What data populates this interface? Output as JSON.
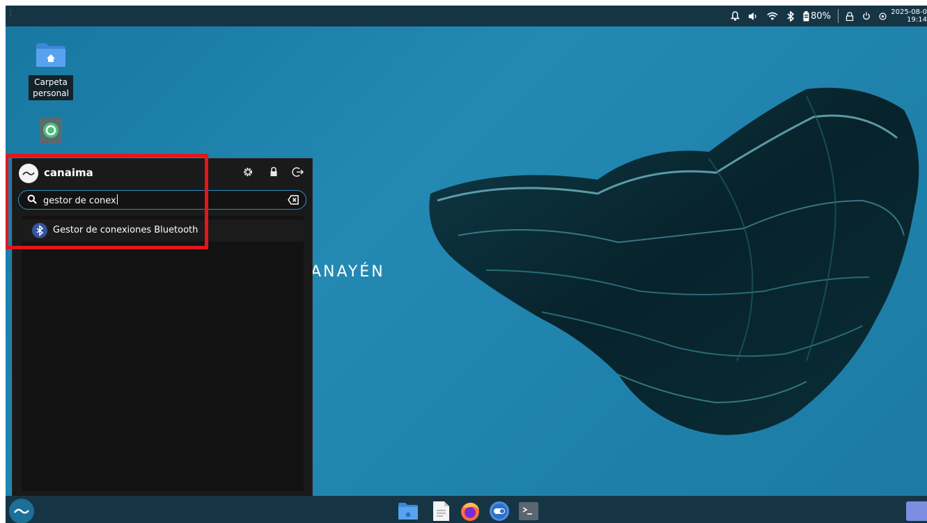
{
  "topbar": {
    "battery_percent": "80%",
    "clock_date": "2025-08-0",
    "clock_time": "19:14"
  },
  "desktop": {
    "icons": [
      {
        "label": "Carpeta personal"
      },
      {
        "label": ""
      }
    ],
    "wallpaper_text": "ANAYÉN"
  },
  "menu": {
    "username": "canaima",
    "search": {
      "value": "gestor de conex"
    },
    "results": [
      {
        "label": "Gestor de conexiones Bluetooth",
        "icon": "bluetooth-icon"
      }
    ]
  },
  "colors": {
    "accent": "#2e8fc7",
    "highlight": "#e3161b",
    "panel": "#163544",
    "desktop": "#1e7ea3"
  }
}
